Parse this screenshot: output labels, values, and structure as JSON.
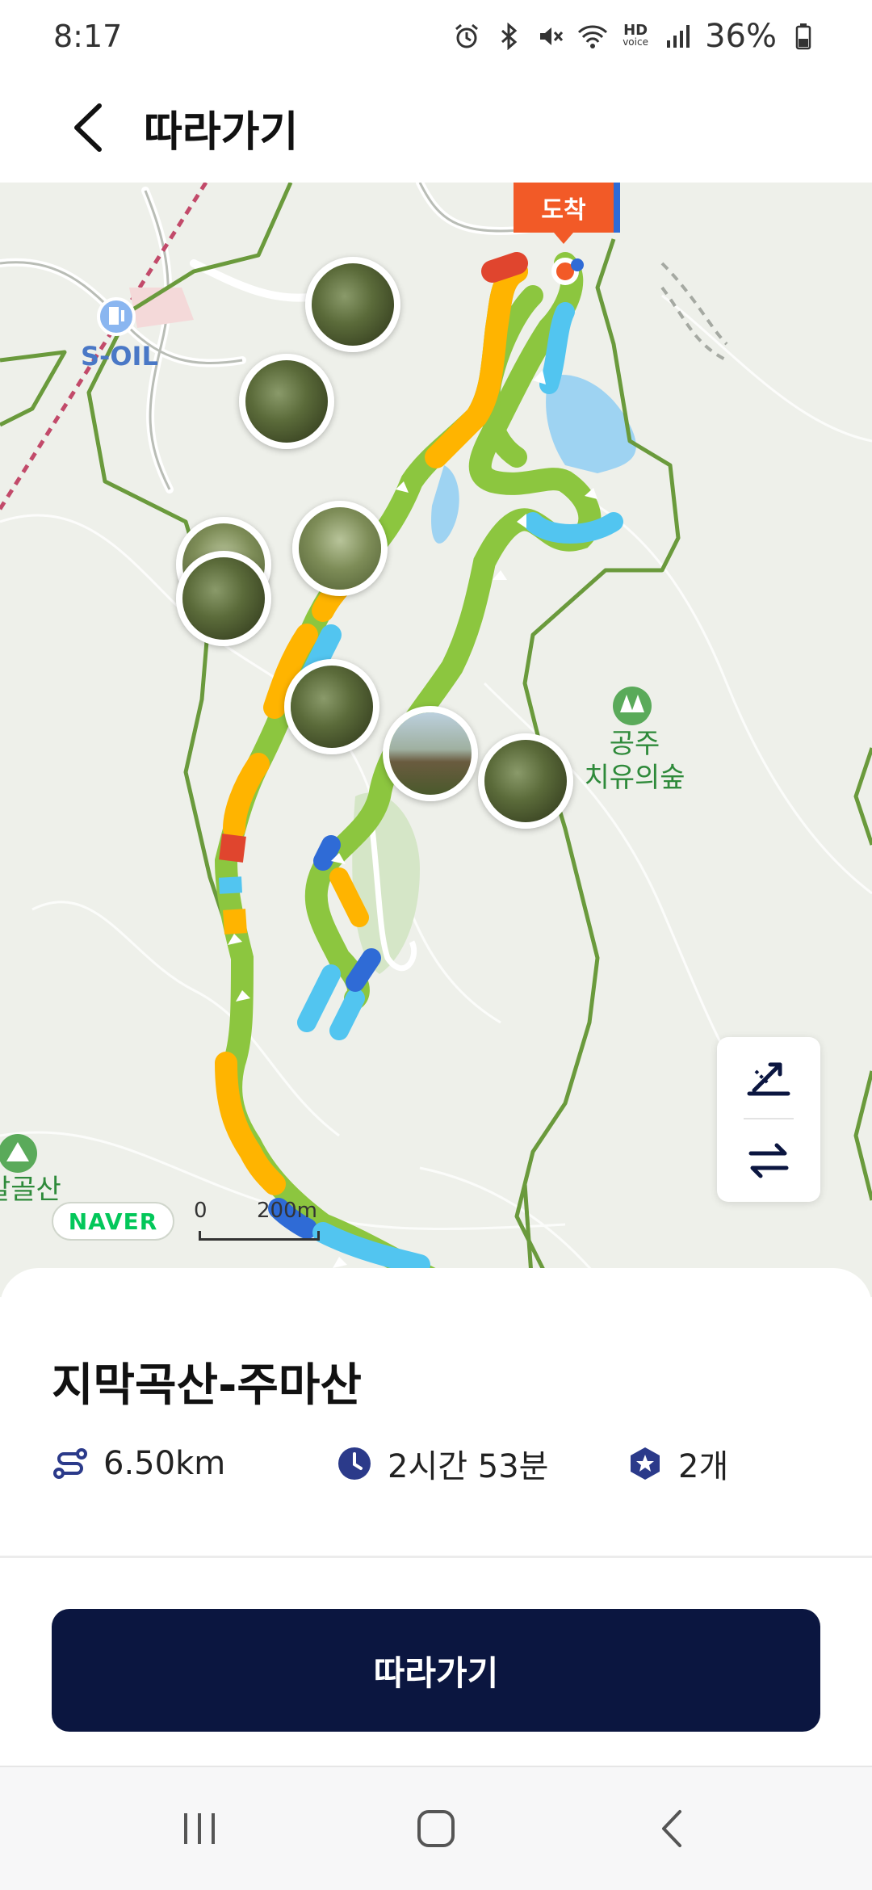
{
  "status_bar": {
    "time": "8:17",
    "battery": "36%",
    "icons": [
      "alarm-icon",
      "bluetooth-icon",
      "mute-icon",
      "wifi-icon",
      "hd-voice-icon",
      "signal-icon",
      "battery-icon"
    ],
    "hd_label": "HD",
    "voice_label": "voice"
  },
  "header": {
    "title": "따라가기",
    "back_icon": "chevron-left-icon"
  },
  "map": {
    "arrival_label": "도착",
    "gas_station_label": "S-OIL",
    "poi_label_line1": "공주",
    "poi_label_line2": "치유의숲",
    "mountain_label": "발골산",
    "provider": "NAVER",
    "scale_zero": "0",
    "scale_distance": "200m",
    "controls": [
      "elevation-icon",
      "reverse-direction-icon"
    ]
  },
  "course": {
    "name": "지막곡산-주마산",
    "distance": "6.50km",
    "duration": "2시간 53분",
    "badges": "2개"
  },
  "actions": {
    "follow_button": "따라가기"
  },
  "navbar": {
    "items": [
      "recent-apps-icon",
      "home-icon",
      "back-icon"
    ]
  },
  "colors": {
    "primary_button": "#0b1640",
    "arrival_marker": "#f25a27",
    "route_green": "#8cc63f",
    "route_yellow": "#ffb400",
    "route_blue": "#52c5f0",
    "route_red": "#e0452e",
    "boundary_green": "#6a9a3c",
    "naver_green": "#03c75a"
  }
}
